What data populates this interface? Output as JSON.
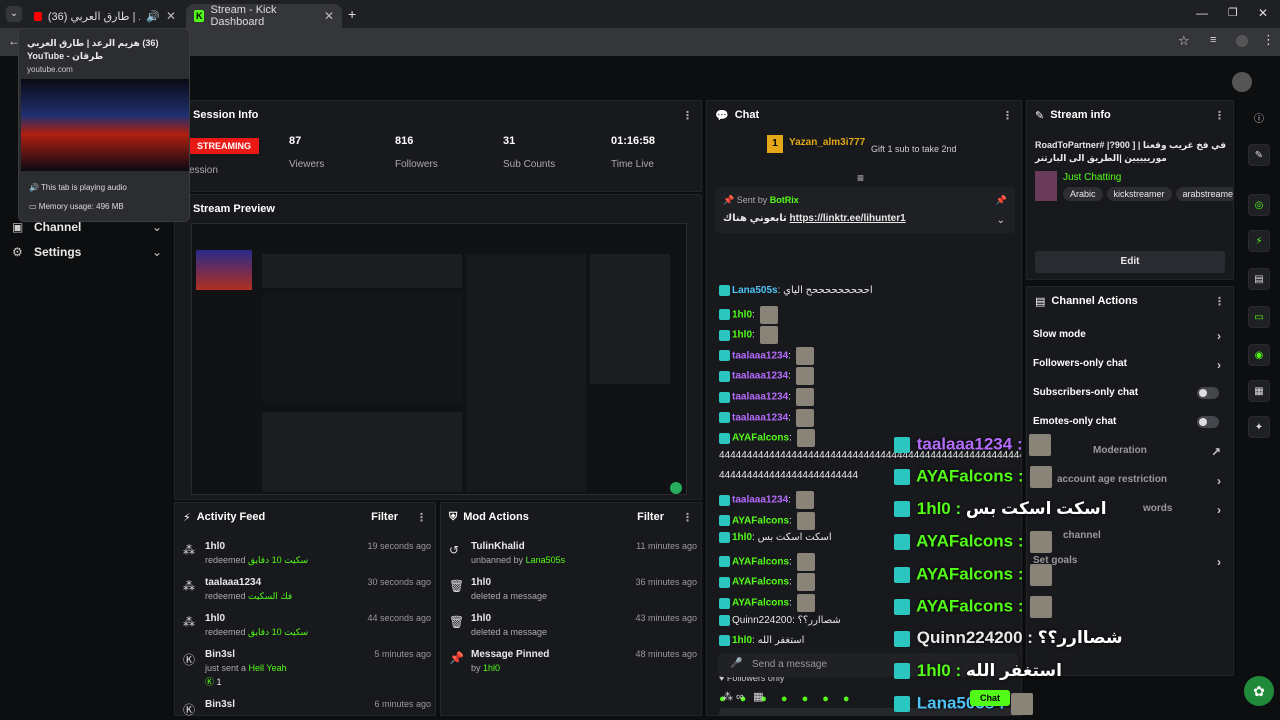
{
  "browser": {
    "tab1_title": "(36) هزيم الرعد | طارق العربي",
    "tab2_title": "Stream - Kick Dashboard",
    "url_partial": "stream",
    "tooltip": {
      "title": "(36) هزيم الرعد | طارق العربي طرقان - YouTube",
      "domain": "youtube.com",
      "audio": "This tab is playing audio",
      "memory": "Memory usage: 496 MB"
    }
  },
  "sidebar": {
    "items": [
      {
        "label": "Channel",
        "icon": "channel-icon"
      },
      {
        "label": "Settings",
        "icon": "gear-icon"
      }
    ]
  },
  "session": {
    "title": "Session Info",
    "badge": "STREAMING",
    "sub": "ession",
    "stats": [
      {
        "value": "87",
        "label": "Viewers"
      },
      {
        "value": "816",
        "label": "Followers"
      },
      {
        "value": "31",
        "label": "Sub Counts"
      },
      {
        "value": "01:16:58",
        "label": "Time Live"
      }
    ]
  },
  "preview": {
    "title": "Stream Preview"
  },
  "activity": {
    "title": "Activity Feed",
    "filter": "Filter",
    "items": [
      {
        "user": "1hl0",
        "action": "redeemed",
        "reward": "سكيت 10 دقايق",
        "time": "19 seconds ago"
      },
      {
        "user": "taalaaa1234",
        "action": "redeemed",
        "reward": "فك السكيت",
        "time": "30 seconds ago"
      },
      {
        "user": "1hl0",
        "action": "redeemed",
        "reward": "سكيت 10 دقايق",
        "time": "44 seconds ago"
      },
      {
        "user": "Bin3sl",
        "action": "just sent a",
        "reward": "Hell Yeah",
        "time": "5 minutes ago",
        "count": "1"
      },
      {
        "user": "Bin3sl",
        "action": "",
        "reward": "",
        "time": "6 minutes ago"
      }
    ]
  },
  "mod": {
    "title": "Mod Actions",
    "filter": "Filter",
    "items": [
      {
        "user": "TulinKhalid",
        "action": "unbanned by",
        "by": "Lana505s",
        "time": "11 minutes ago"
      },
      {
        "user": "1hl0",
        "action": "deleted a message",
        "by": "",
        "time": "36 minutes ago"
      },
      {
        "user": "1hl0",
        "action": "deleted a message",
        "by": "",
        "time": "43 minutes ago"
      },
      {
        "user": "Message Pinned",
        "action": "by",
        "by": "1hl0",
        "time": "48 minutes ago"
      }
    ]
  },
  "chat": {
    "title": "Chat",
    "top_gifter": "Yazan_alm3i777",
    "top_rank": "1",
    "gift_text": "Gift 1 sub to take 2nd",
    "pinned_sent_by": "Sent by",
    "pinned_user": "BotRix",
    "pinned_text": "تابعوني هناك",
    "pinned_link": "https://linktr.ee/lihunter1",
    "messages": [
      {
        "user": "Lana505s",
        "text": "احححححححححح الياي",
        "color": "b"
      },
      {
        "user": "1hl0",
        "text": "",
        "color": "g"
      },
      {
        "user": "1hl0",
        "text": "",
        "color": "g"
      },
      {
        "user": "taalaaa1234",
        "text": "",
        "color": "p"
      },
      {
        "user": "taalaaa1234",
        "text": "",
        "color": "p"
      },
      {
        "user": "taalaaa1234",
        "text": "",
        "color": "p"
      },
      {
        "user": "taalaaa1234",
        "text": "",
        "color": "p"
      },
      {
        "user": "AYAFalcons",
        "text": "",
        "color": "g"
      },
      {
        "user": "",
        "text": "4444444444444444444444444444444444444444444444444444444444444444444444",
        "color": "w"
      },
      {
        "user": "",
        "text": "4444444444444444444444444",
        "color": "w"
      },
      {
        "user": "taalaaa1234",
        "text": "",
        "color": "p"
      },
      {
        "user": "AYAFalcons",
        "text": "",
        "color": "g"
      },
      {
        "user": "1hl0",
        "text": "اسكت اسكت بس",
        "color": "g"
      },
      {
        "user": "AYAFalcons",
        "text": "",
        "color": "g"
      },
      {
        "user": "AYAFalcons",
        "text": "",
        "color": "g"
      },
      {
        "user": "AYAFalcons",
        "text": "",
        "color": "g"
      },
      {
        "user": "Quinn224200",
        "text": "شصاارر؟؟",
        "color": "w"
      },
      {
        "user": "1hl0",
        "text": "استغفر الله",
        "color": "g"
      },
      {
        "user": "Lana505s",
        "text": "",
        "color": "b"
      }
    ],
    "followers_only": "Followers only",
    "placeholder": "Send a message",
    "send": "Chat"
  },
  "streaminfo": {
    "title": "Stream info",
    "stream_title": "في فخ غريب وقعنا | [ 900?| #RoadToPartner مورييييين |الطريق الى البارتنر",
    "category": "Just Chatting",
    "tags": [
      "Arabic",
      "kickstreamer",
      "arabstreame"
    ],
    "edit": "Edit"
  },
  "actions": {
    "title": "Channel Actions",
    "items": [
      {
        "label": "Slow mode",
        "type": "chevron"
      },
      {
        "label": "Followers-only chat",
        "type": "chevron"
      },
      {
        "label": "Subscribers-only chat",
        "type": "toggle"
      },
      {
        "label": "Emotes-only chat",
        "type": "toggle"
      },
      {
        "label": "Moderation",
        "type": "link"
      },
      {
        "label": "account age restriction",
        "type": "chevron"
      },
      {
        "label": "words",
        "type": "chevron"
      },
      {
        "label": "channel",
        "type": "none"
      },
      {
        "label": "Set goals",
        "type": "chevron"
      }
    ]
  },
  "overlay": [
    {
      "user": "taalaaa1234",
      "text": "",
      "color": "p"
    },
    {
      "user": "AYAFalcons",
      "text": "",
      "color": "g"
    },
    {
      "user": "1hl0",
      "text": "اسكت اسكت بس",
      "color": "g"
    },
    {
      "user": "AYAFalcons",
      "text": "",
      "color": "g"
    },
    {
      "user": "AYAFalcons",
      "text": "",
      "color": "g"
    },
    {
      "user": "AYAFalcons",
      "text": "",
      "color": "g"
    },
    {
      "user": "Quinn224200",
      "text": "شصاارر؟؟",
      "color": "w"
    },
    {
      "user": "1hl0",
      "text": "استغفر الله",
      "color": "g"
    },
    {
      "user": "Lana505s",
      "text": "",
      "color": "b"
    }
  ],
  "colors": {
    "accent": "#53fc18",
    "live": "#e91916",
    "bg": "#0d0e10",
    "panel": "#18191c"
  }
}
